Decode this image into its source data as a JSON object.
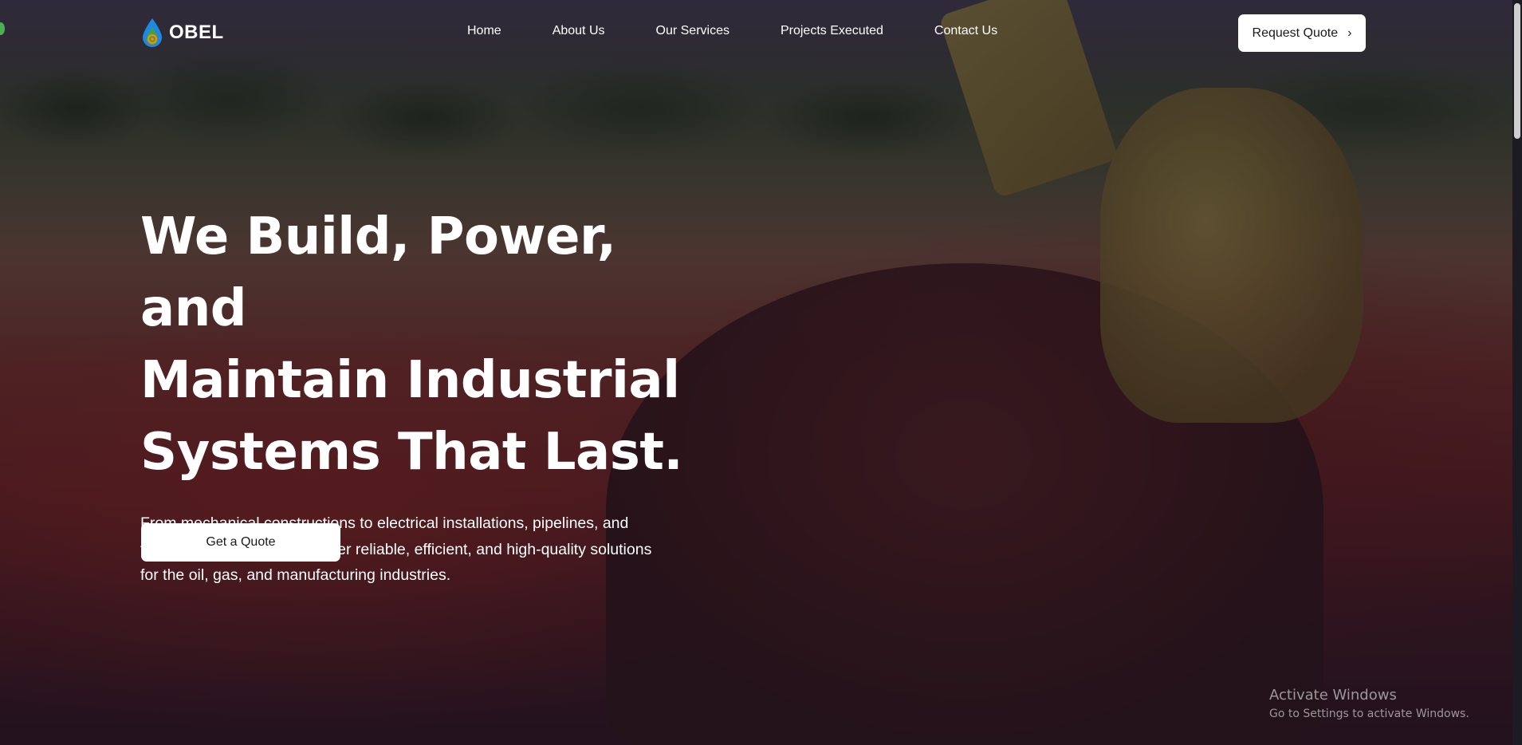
{
  "brand": {
    "name": "OBEL"
  },
  "nav": {
    "items": [
      {
        "label": "Home"
      },
      {
        "label": "About Us"
      },
      {
        "label": "Our Services"
      },
      {
        "label": "Projects Executed"
      },
      {
        "label": "Contact Us"
      }
    ]
  },
  "header": {
    "request_quote_label": "Request Quote"
  },
  "hero": {
    "heading_lines": [
      "We Build, Power, and",
      "Maintain Industrial",
      "Systems That Last."
    ],
    "description_lines": [
      "From mechanical constructions to electrical installations, pipelines, and",
      "facility maintenance we deliver reliable, efficient, and high-quality solutions",
      "for the oil, gas, and manufacturing industries."
    ],
    "cta_label": "Get a Quote"
  },
  "watermark": {
    "title": "Activate Windows",
    "subtitle": "Go to Settings to activate Windows."
  },
  "colors": {
    "button_bg": "#ffffff",
    "text_primary": "#ffffff",
    "logo_blue": "#1e88e5",
    "logo_green": "#43a047",
    "logo_orange": "#fb8c00"
  }
}
